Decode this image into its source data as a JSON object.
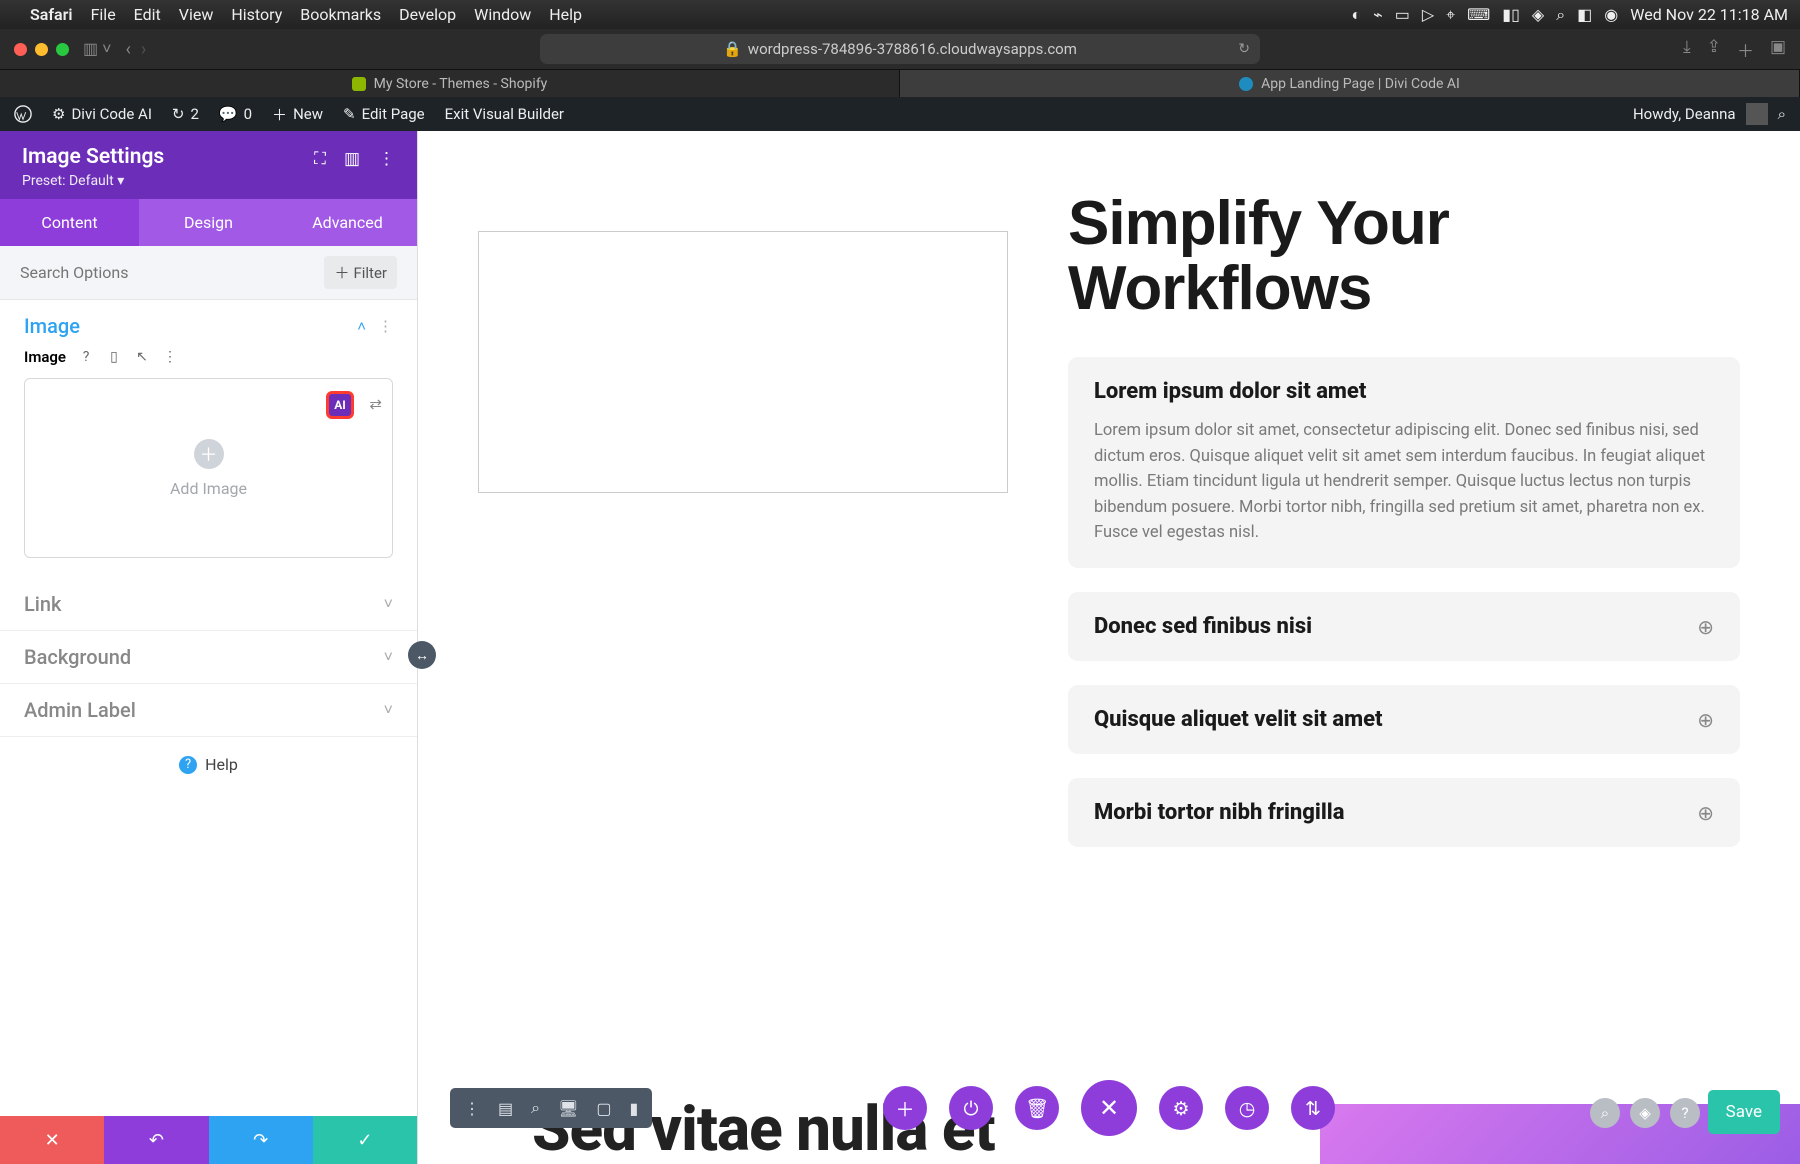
{
  "menubar": {
    "app": "Safari",
    "items": [
      "File",
      "Edit",
      "View",
      "History",
      "Bookmarks",
      "Develop",
      "Window",
      "Help"
    ],
    "clock": "Wed Nov 22  11:18 AM"
  },
  "safari": {
    "url": "wordpress-784896-3788616.cloudwaysapps.com",
    "tabs": [
      {
        "label": "My Store - Themes - Shopify",
        "favicon": "#8db600"
      },
      {
        "label": "App Landing Page | Divi Code AI",
        "favicon": "#1e8cbe"
      }
    ]
  },
  "wpbar": {
    "site": "Divi Code AI",
    "revisions": "2",
    "comments": "0",
    "new": "New",
    "edit_page": "Edit Page",
    "exit": "Exit Visual Builder",
    "howdy": "Howdy, Deanna"
  },
  "sidebar": {
    "title": "Image Settings",
    "preset": "Preset: Default",
    "tabs": [
      "Content",
      "Design",
      "Advanced"
    ],
    "active_tab": 0,
    "search_placeholder": "Search Options",
    "filter_label": "Filter",
    "sections": {
      "image": {
        "title": "Image",
        "field_label": "Image",
        "add_label": "Add Image",
        "ai_badge": "AI"
      },
      "link": {
        "title": "Link"
      },
      "background": {
        "title": "Background"
      },
      "admin_label": {
        "title": "Admin Label"
      }
    },
    "help": "Help",
    "footer_save": "Save"
  },
  "page": {
    "heading": "Simplify Your Workflows",
    "accordion": [
      {
        "title": "Lorem ipsum dolor sit amet",
        "open": true,
        "body": "Lorem ipsum dolor sit amet, consectetur adipiscing elit. Donec sed finibus nisi, sed dictum eros. Quisque aliquet velit sit amet sem interdum faucibus. In feugiat aliquet mollis. Etiam tincidunt ligula ut hendrerit semper. Quisque luctus lectus non turpis bibendum posuere. Morbi tortor nibh, fringilla sed pretium sit amet, pharetra non ex. Fusce vel egestas nisl."
      },
      {
        "title": "Donec sed finibus nisi",
        "open": false,
        "body": ""
      },
      {
        "title": "Quisque aliquet velit sit amet",
        "open": false,
        "body": ""
      },
      {
        "title": "Morbi tortor nibh fringilla",
        "open": false,
        "body": ""
      }
    ],
    "next_heading": "Sed vitae nulla et"
  },
  "divi_bottom": {
    "save": "Save"
  }
}
